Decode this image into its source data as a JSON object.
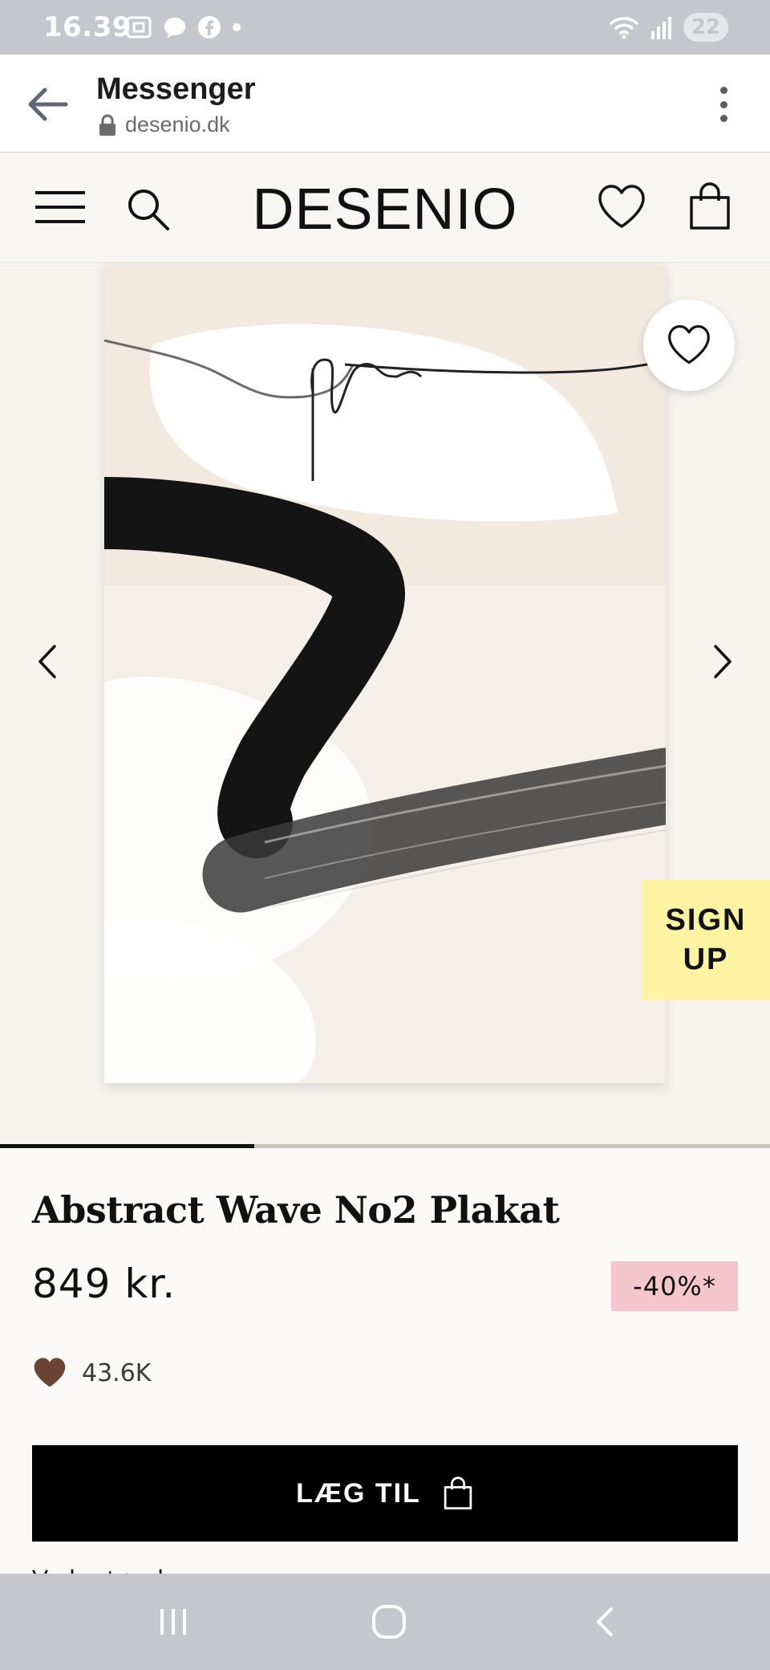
{
  "status_bar": {
    "time": "16.39",
    "battery": "22"
  },
  "browser": {
    "title": "Messenger",
    "url": "desenio.dk"
  },
  "site_header": {
    "logo": "DESENIO"
  },
  "gallery": {
    "signup_line1": "SIGN",
    "signup_line2": "UP",
    "progress_fraction": 0.33
  },
  "product": {
    "title": "Abstract Wave No2 Plakat",
    "price": "849 kr.",
    "discount": "-40%*",
    "likes": "43.6K",
    "add_to_cart": "LÆG TIL",
    "cut_off_text": "Vælg størrelse"
  },
  "colors": {
    "signup_bg": "#fcf3a3",
    "discount_bg": "#f5c6cc",
    "like_heart": "#6b4433",
    "cta_bg": "#000000"
  },
  "icons": {
    "back": "arrow-left-icon",
    "lock": "lock-icon",
    "more": "kebab-icon",
    "menu": "hamburger-icon",
    "search": "search-icon",
    "wishlist": "heart-outline-icon",
    "bag": "shopping-bag-icon",
    "prev": "chevron-left-icon",
    "next": "chevron-right-icon"
  }
}
